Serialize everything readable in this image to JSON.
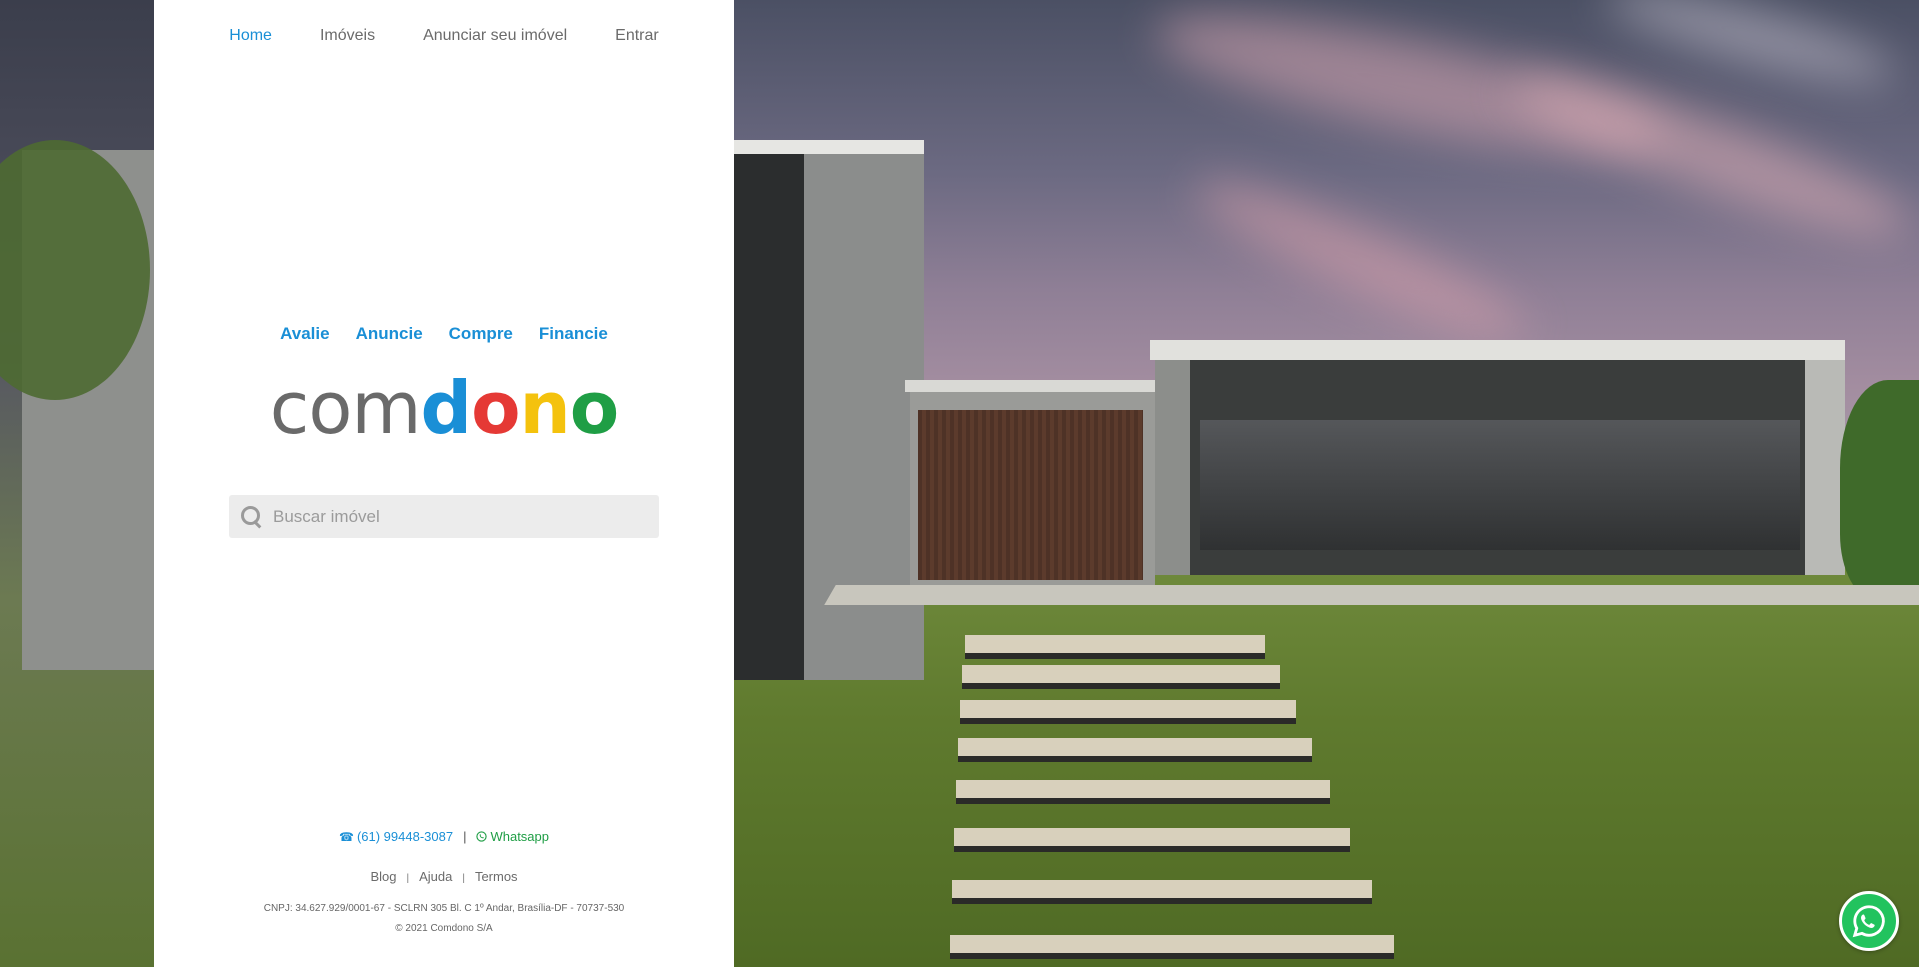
{
  "nav": {
    "items": [
      {
        "label": "Home",
        "active": true
      },
      {
        "label": "Imóveis",
        "active": false
      },
      {
        "label": "Anunciar seu imóvel",
        "active": false
      },
      {
        "label": "Entrar",
        "active": false
      }
    ]
  },
  "actions": [
    "Avalie",
    "Anuncie",
    "Compre",
    "Financie"
  ],
  "logo": {
    "parts": [
      {
        "text": "com",
        "color": "#6a6a6a"
      },
      {
        "text": "d",
        "color": "#1a8fd6"
      },
      {
        "text": "o",
        "color": "#e53935"
      },
      {
        "text": "n",
        "color": "#f4c20d"
      },
      {
        "text": "o",
        "color": "#1f9e45"
      }
    ]
  },
  "search": {
    "placeholder": "Buscar imóvel",
    "icon": "search-icon"
  },
  "contact": {
    "phone": "(61) 99448-3087",
    "separator": "|",
    "whatsapp": "Whatsapp",
    "phone_icon": "phone-icon",
    "whatsapp_icon": "whatsapp-icon"
  },
  "footer": {
    "links": [
      "Blog",
      "Ajuda",
      "Termos"
    ],
    "separator": "|",
    "cnpj": "CNPJ: 34.627.929/0001-67 - SCLRN 305 Bl. C 1º Andar, Brasília-DF - 70737-530",
    "copyright": "© 2021 Comdono S/A"
  },
  "floating_button": {
    "icon": "whatsapp-icon"
  },
  "colors": {
    "accent": "#1a8fd6",
    "whatsapp": "#1f9e45",
    "text": "#6b6b6b"
  }
}
